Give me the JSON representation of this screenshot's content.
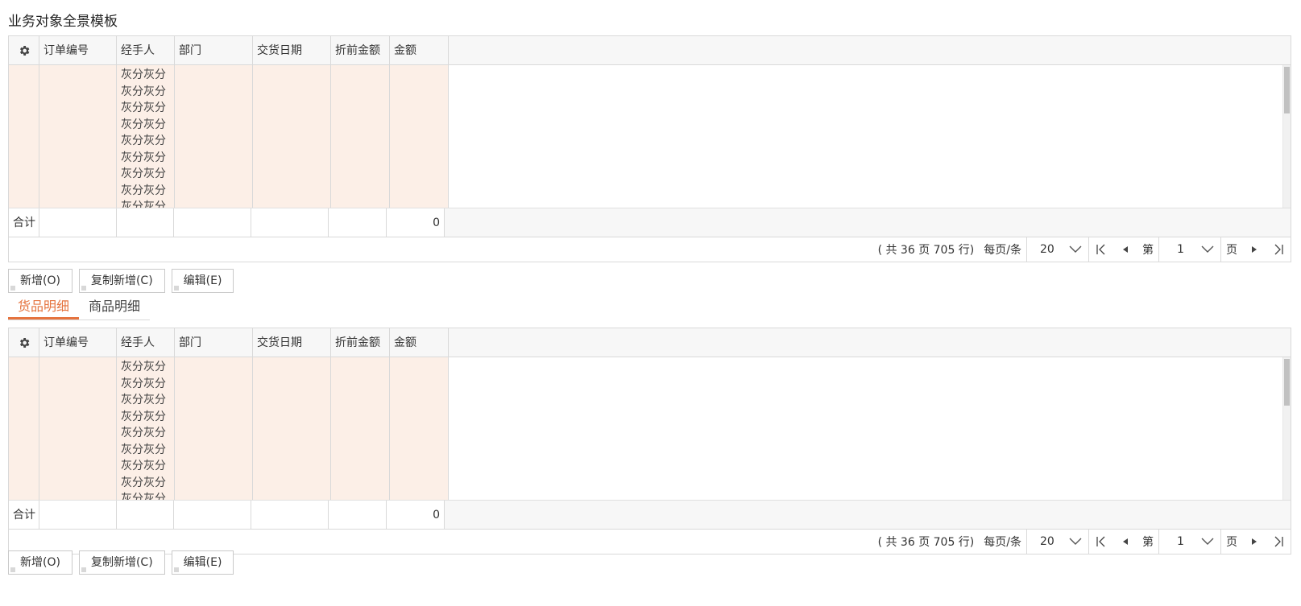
{
  "page": {
    "title": "业务对象全景模板"
  },
  "columns": [
    "订单编号",
    "经手人",
    "部门",
    "交货日期",
    "折前金额",
    "金额"
  ],
  "cell_text": "灰分灰分灰分灰分灰分灰分灰分灰分灰分灰分灰分灰分灰分灰分灰分灰分灰分灰分",
  "totals": {
    "label": "合计",
    "amount": "0"
  },
  "pager": {
    "info": "( 共 36 页 705 行)",
    "per_page_label": "每页/条",
    "per_page_value": "20",
    "page_prefix": "第",
    "page_value": "1",
    "page_suffix": "页"
  },
  "buttons": {
    "add": "新增(O)",
    "copy_add": "复制新增(C)",
    "edit": "编辑(E)"
  },
  "tabs": [
    "货品明细",
    "商品明细"
  ],
  "colors": {
    "accent": "#e5733e",
    "row_bg": "#fcefe7",
    "header_bg": "#f7f7f7",
    "border": "#d9d9d9"
  },
  "icons": {
    "settings": "gear-icon",
    "dropdown": "chevron-down-icon",
    "first": "first-page-icon",
    "prev": "prev-page-icon",
    "next": "next-page-icon",
    "last": "last-page-icon"
  }
}
